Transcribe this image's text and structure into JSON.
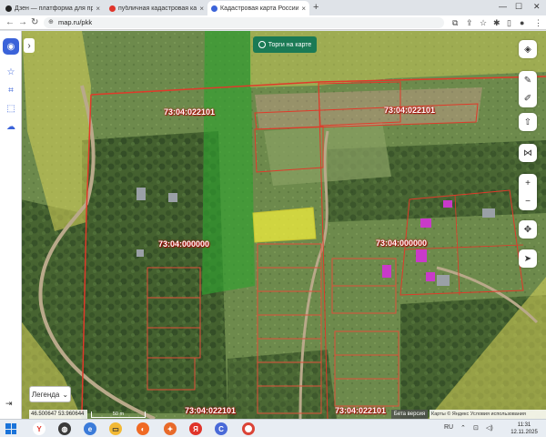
{
  "browser": {
    "tabs": [
      {
        "label": "Дзен — платформа для просмотра",
        "icon": "dzen-icon",
        "color": "#222222"
      },
      {
        "label": "публичная кадастровая карта - Яндекс",
        "icon": "yandex-icon",
        "color": "#e0342a"
      },
      {
        "label": "Кадастровая карта России онлайн",
        "icon": "map-icon",
        "color": "#3b63d9"
      }
    ],
    "new_tab_glyph": "+",
    "url": "map.ru/pkk"
  },
  "map": {
    "top_button": "Торги на карте",
    "cadastral_labels": [
      {
        "text": "73:04:022101",
        "name": "cadastral-label-north"
      },
      {
        "text": "73:04:022101",
        "name": "cadastral-label-northeast"
      },
      {
        "text": "73:04:000000",
        "name": "cadastral-label-west"
      },
      {
        "text": "73:04:000000",
        "name": "cadastral-label-east"
      },
      {
        "text": "73:04:022101",
        "name": "cadastral-label-south"
      },
      {
        "text": "73:04:022101",
        "name": "cadastral-label-southeast"
      }
    ],
    "legend_label": "Легенда",
    "coordinates": "46.500647  53.960644",
    "scale_label": "50 m",
    "beta_label": "Бета версия",
    "attribution": "Карты © Яндекс   Условия использования"
  },
  "taskbar": {
    "language": "RU",
    "time": "11:31",
    "date": "12.11.2025"
  },
  "colors": {
    "accent": "#3b63d9",
    "torgi": "#1b7a55",
    "parcel_border": "#e03a2a",
    "selected_parcel": "#f2ee3c"
  }
}
